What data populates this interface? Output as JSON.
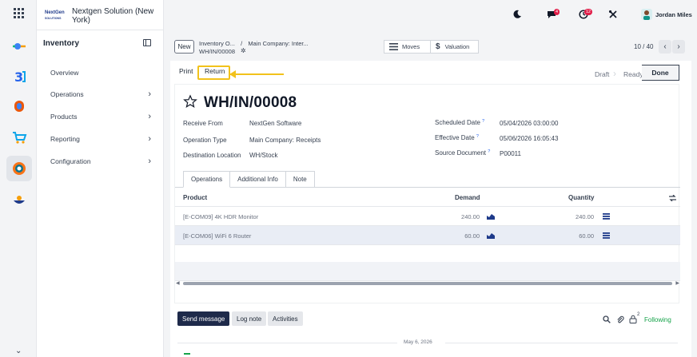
{
  "company": {
    "logo_line1": "NextGen",
    "logo_line2": "SOLUTIONS",
    "name": "Nextgen Solution (New York)"
  },
  "sidebar": {
    "title": "Inventory",
    "items": [
      {
        "label": "Overview"
      },
      {
        "label": "Operations"
      },
      {
        "label": "Products"
      },
      {
        "label": "Reporting"
      },
      {
        "label": "Configuration"
      }
    ]
  },
  "topbar": {
    "messages_badge": "4",
    "activities_badge": "12",
    "user_name": "Jordan Miles"
  },
  "control": {
    "new_label": "New",
    "breadcrumb_1": "Inventory O...",
    "breadcrumb_sep": "/",
    "breadcrumb_2": "Main Company: Inter...",
    "breadcrumb_current": "WH/IN/00008",
    "moves_label": "Moves",
    "valuation_label": "Valuation",
    "pager": "10 / 40"
  },
  "statusbar": {
    "print_label": "Print",
    "return_label": "Return",
    "stages": [
      "Draft",
      "Ready",
      "Done"
    ]
  },
  "form": {
    "reference": "WH/IN/00008",
    "receive_from_label": "Receive From",
    "receive_from_value": "NextGen Software",
    "operation_type_label": "Operation Type",
    "operation_type_value": "Main Company: Receipts",
    "destination_label": "Destination Location",
    "destination_value": "WH/Stock",
    "scheduled_date_label": "Scheduled Date",
    "scheduled_date_value": "05/04/2026 03:00:00",
    "effective_date_label": "Effective Date",
    "effective_date_value": "05/06/2026 16:05:43",
    "source_document_label": "Source Document",
    "source_document_value": "P00011",
    "help_mark": "?"
  },
  "tabs": [
    "Operations",
    "Additional Info",
    "Note"
  ],
  "table": {
    "headers": {
      "product": "Product",
      "demand": "Demand",
      "quantity": "Quantity"
    },
    "rows": [
      {
        "product": "[E-COM09] 4K HDR Monitor",
        "demand": "240.00",
        "quantity": "240.00"
      },
      {
        "product": "[E-COM06] WiFi 6 Router",
        "demand": "60.00",
        "quantity": "60.00"
      }
    ]
  },
  "chatter": {
    "send_message": "Send message",
    "log_note": "Log note",
    "activities": "Activities",
    "followers_count": "2",
    "following": "Following",
    "date_separator": "May 6, 2026"
  },
  "colors": {
    "accent_navy": "#1e2a4a",
    "highlight_yellow": "#f2c21b",
    "following_green": "#16a34a",
    "badge_red": "#e11d48"
  },
  "icons": {
    "apps": "grid-icon",
    "star": "star-icon",
    "moves": "list-icon",
    "valuation": "dollar-icon",
    "forecast": "chart-icon",
    "details": "list-details-icon"
  }
}
